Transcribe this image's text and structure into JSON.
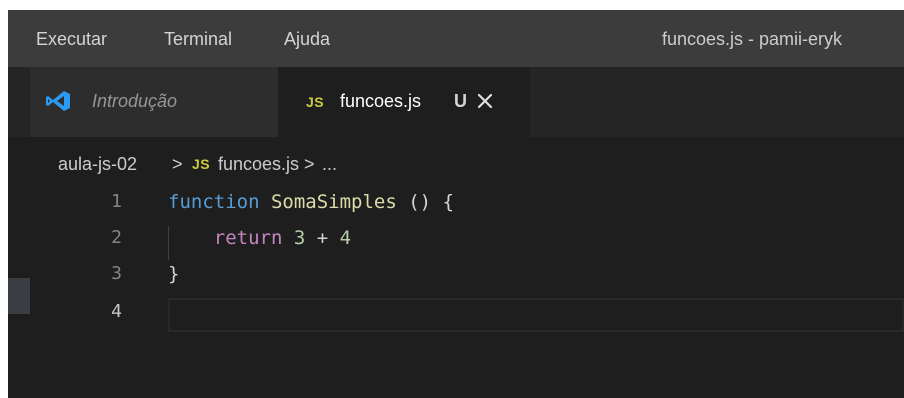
{
  "menu": {
    "items": [
      "Executar",
      "Terminal",
      "Ajuda"
    ]
  },
  "window_title": "funcoes.js - pamii-eryk",
  "tabs": [
    {
      "label": "Introdução",
      "icon": "vscode-icon",
      "active": false
    },
    {
      "label": "funcoes.js",
      "badge": "JS",
      "status": "U",
      "icon": "close-icon",
      "active": true
    }
  ],
  "breadcrumb": {
    "folder": "aula-js-02",
    "sep1": ">",
    "badge": "JS",
    "file": "funcoes.js",
    "sep2": ">",
    "ellipsis": "..."
  },
  "editor": {
    "line_numbers": [
      "1",
      "2",
      "3",
      "4"
    ],
    "lines": [
      {
        "t1": "function",
        "t2": " SomaSimples ",
        "t3": "()",
        "t4": " {"
      },
      {
        "t1": "    return",
        "t2": " 3",
        "t3": " + ",
        "t4": "4"
      },
      {
        "t1": "}"
      },
      {
        "t1": ""
      }
    ]
  },
  "colors": {
    "accent": "#007acc",
    "keyword": "#569cd6",
    "function": "#dcdcaa",
    "return": "#c586c0",
    "number": "#b5cea8",
    "brace": "#ffd700",
    "js_badge": "#cbcb41"
  }
}
